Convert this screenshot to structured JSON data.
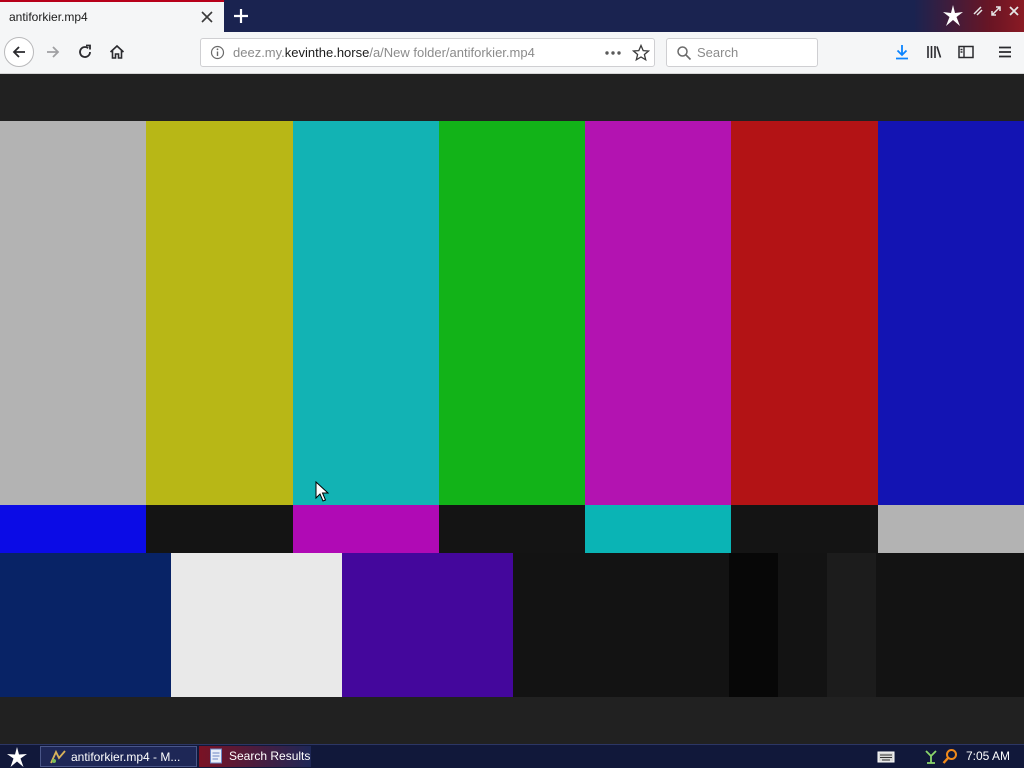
{
  "browser": {
    "tab": {
      "title": "antiforkier.mp4"
    },
    "url": {
      "prefix": "deez.my.",
      "host": "kevinthe.horse",
      "path": "/a/New folder/antiforkier.mp4"
    },
    "search": {
      "placeholder": "Search"
    }
  },
  "test_pattern": {
    "top_bars": [
      "#b3b3b3",
      "#b8b716",
      "#12b3b4",
      "#12b318",
      "#b313b1",
      "#b31315",
      "#1314b3"
    ],
    "middle_bars": [
      "#0b0be6",
      "#141414",
      "#b00ab5",
      "#141414",
      "#0ab4b5",
      "#141414",
      "#b3b3b3"
    ],
    "bottom_left_bars": [
      "#082366",
      "#e9e9e9",
      "#44079c"
    ],
    "pluge_bars": [
      "#131313",
      "#070707",
      "#131313",
      "#1c1c1c",
      "#131313"
    ]
  },
  "taskbar": {
    "tasks": [
      {
        "label": "antiforkier.mp4 - M..."
      },
      {
        "label": "Search Results"
      }
    ],
    "clock": "7:05 AM"
  },
  "colors": {
    "tab_accent": "#b8001a",
    "taskbar": "#11183a",
    "download_arrow": "#0a84ff"
  }
}
